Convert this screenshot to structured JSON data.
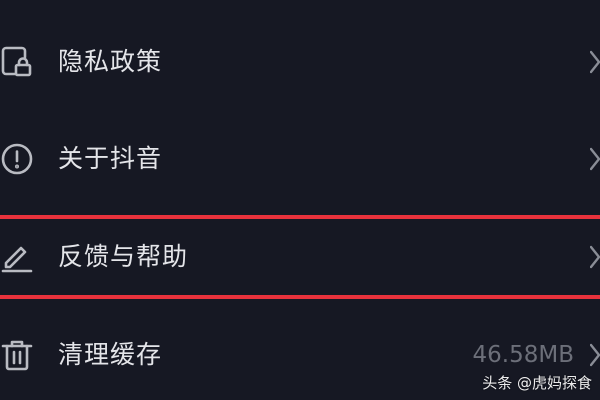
{
  "settings": {
    "items": [
      {
        "icon": "privacy-lock-icon",
        "label": "隐私政策"
      },
      {
        "icon": "info-circle-icon",
        "label": "关于抖音"
      },
      {
        "icon": "edit-pen-icon",
        "label": "反馈与帮助"
      },
      {
        "icon": "trash-icon",
        "label": "清理缓存",
        "value": "46.58MB"
      }
    ]
  },
  "highlight": {
    "color": "#e8323c",
    "target": "反馈与帮助"
  },
  "watermark": {
    "text": "头条 @虎妈探食"
  },
  "colors": {
    "background": "#161823",
    "text": "#e4e5e9",
    "muted": "#6c6f79",
    "icon": "#b9bbc2"
  }
}
